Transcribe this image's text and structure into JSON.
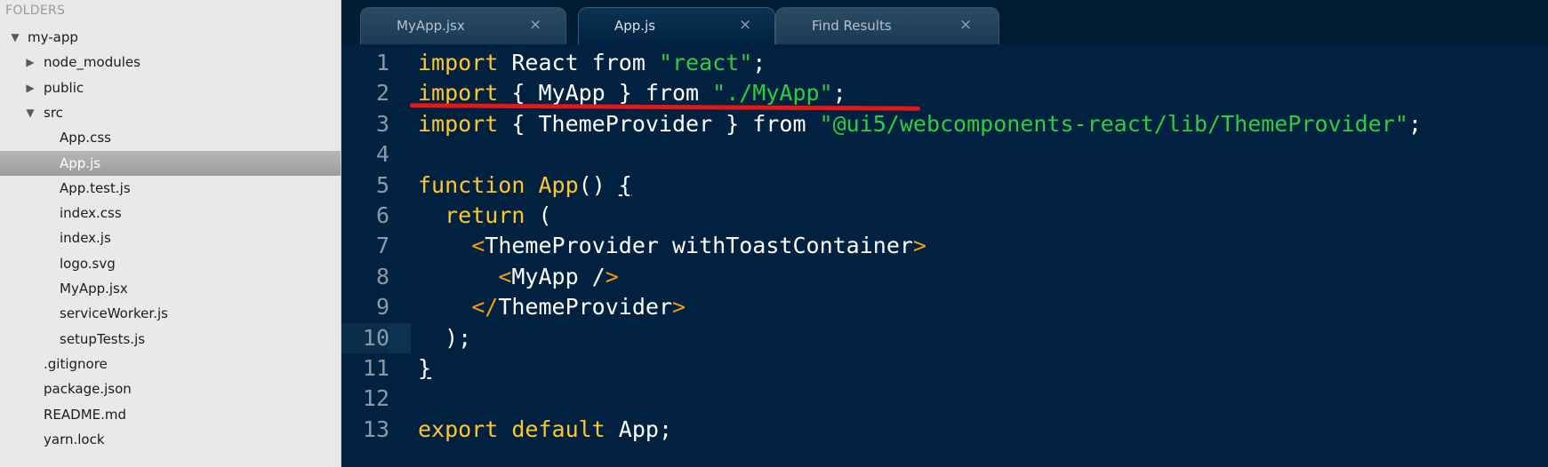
{
  "sidebar": {
    "header": "FOLDERS",
    "rows": [
      {
        "label": "my-app",
        "arrow": "▼",
        "depth": 0
      },
      {
        "label": "node_modules",
        "arrow": "▶",
        "depth": 1
      },
      {
        "label": "public",
        "arrow": "▶",
        "depth": 1
      },
      {
        "label": "src",
        "arrow": "▼",
        "depth": 1
      },
      {
        "label": "App.css",
        "arrow": "",
        "depth": 2
      },
      {
        "label": "App.js",
        "arrow": "",
        "depth": 2,
        "selected": true
      },
      {
        "label": "App.test.js",
        "arrow": "",
        "depth": 2
      },
      {
        "label": "index.css",
        "arrow": "",
        "depth": 2
      },
      {
        "label": "index.js",
        "arrow": "",
        "depth": 2
      },
      {
        "label": "logo.svg",
        "arrow": "",
        "depth": 2
      },
      {
        "label": "MyApp.jsx",
        "arrow": "",
        "depth": 2
      },
      {
        "label": "serviceWorker.js",
        "arrow": "",
        "depth": 2
      },
      {
        "label": "setupTests.js",
        "arrow": "",
        "depth": 2
      },
      {
        "label": ".gitignore",
        "arrow": "",
        "depth": 1
      },
      {
        "label": "package.json",
        "arrow": "",
        "depth": 1
      },
      {
        "label": "README.md",
        "arrow": "",
        "depth": 1
      },
      {
        "label": "yarn.lock",
        "arrow": "",
        "depth": 1
      }
    ]
  },
  "tabs": [
    {
      "label": "MyApp.jsx",
      "close": "×",
      "active": false
    },
    {
      "label": "App.js",
      "close": "×",
      "active": true
    },
    {
      "label": "Find Results",
      "close": "×",
      "active": false
    }
  ],
  "editor": {
    "current_line": 10,
    "lines": [
      {
        "n": "1",
        "tokens": [
          {
            "t": "import",
            "c": "kw"
          },
          {
            "t": " React from ",
            "c": "plain"
          },
          {
            "t": "\"react\"",
            "c": "str"
          },
          {
            "t": ";",
            "c": "plain"
          }
        ]
      },
      {
        "n": "2",
        "tokens": [
          {
            "t": "import",
            "c": "kw"
          },
          {
            "t": " { MyApp } from ",
            "c": "plain"
          },
          {
            "t": "\"./MyApp\"",
            "c": "str"
          },
          {
            "t": ";",
            "c": "plain"
          }
        ]
      },
      {
        "n": "3",
        "tokens": [
          {
            "t": "import",
            "c": "kw"
          },
          {
            "t": " { ThemeProvider } from ",
            "c": "plain"
          },
          {
            "t": "\"@ui5/webcomponents-react/lib/ThemeProvider\"",
            "c": "str"
          },
          {
            "t": ";",
            "c": "plain"
          }
        ]
      },
      {
        "n": "4",
        "tokens": []
      },
      {
        "n": "5",
        "tokens": [
          {
            "t": "function",
            "c": "kw"
          },
          {
            "t": " ",
            "c": "plain"
          },
          {
            "t": "App",
            "c": "kw"
          },
          {
            "t": "() ",
            "c": "plain"
          },
          {
            "t": "{",
            "c": "plain underline"
          }
        ]
      },
      {
        "n": "6",
        "tokens": [
          {
            "t": "  ",
            "c": "plain"
          },
          {
            "t": "return",
            "c": "kw"
          },
          {
            "t": " (",
            "c": "plain"
          }
        ]
      },
      {
        "n": "7",
        "tokens": [
          {
            "t": "    ",
            "c": "plain"
          },
          {
            "t": "<",
            "c": "tag"
          },
          {
            "t": "ThemeProvider withToastContainer",
            "c": "plain"
          },
          {
            "t": ">",
            "c": "tag"
          }
        ]
      },
      {
        "n": "8",
        "tokens": [
          {
            "t": "      ",
            "c": "plain"
          },
          {
            "t": "<",
            "c": "tag"
          },
          {
            "t": "MyApp /",
            "c": "plain"
          },
          {
            "t": ">",
            "c": "tag"
          }
        ]
      },
      {
        "n": "9",
        "tokens": [
          {
            "t": "    ",
            "c": "plain"
          },
          {
            "t": "</",
            "c": "tag"
          },
          {
            "t": "ThemeProvider",
            "c": "plain"
          },
          {
            "t": ">",
            "c": "tag"
          }
        ]
      },
      {
        "n": "10",
        "tokens": [
          {
            "t": "  );",
            "c": "plain"
          }
        ]
      },
      {
        "n": "11",
        "tokens": [
          {
            "t": "}",
            "c": "plain underline"
          }
        ]
      },
      {
        "n": "12",
        "tokens": []
      },
      {
        "n": "13",
        "tokens": [
          {
            "t": "export",
            "c": "kw"
          },
          {
            "t": " ",
            "c": "plain"
          },
          {
            "t": "default",
            "c": "kw"
          },
          {
            "t": " App;",
            "c": "plain"
          }
        ]
      }
    ]
  },
  "colors": {
    "editor_bg": "#002240",
    "keyword": "#ffc62a",
    "string": "#2ecc40",
    "tag_bracket": "#f39c12",
    "annotation_red": "#e51717"
  }
}
